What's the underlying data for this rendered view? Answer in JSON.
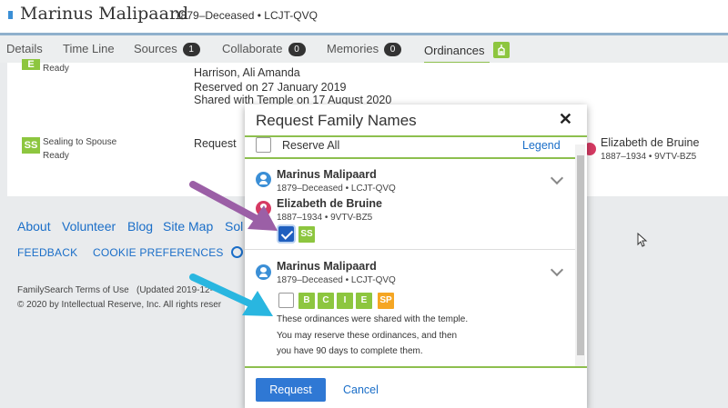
{
  "header": {
    "name": "Marinus Malipaard",
    "meta": "1879–Deceased • LCJT-QVQ"
  },
  "tabs": [
    {
      "label": "Details"
    },
    {
      "label": "Time Line"
    },
    {
      "label": "Sources",
      "count": "1"
    },
    {
      "label": "Collaborate",
      "count": "0"
    },
    {
      "label": "Memories",
      "count": "0"
    },
    {
      "label": "Ordinances",
      "active": true
    }
  ],
  "card": {
    "top_icon": "E",
    "top_status": "Ready",
    "reserved_by": "Harrison, Ali Amanda",
    "reserved_on": "Reserved on 27 January 2019",
    "shared_on": "Shared with Temple on 17 August 2020",
    "sealing_icon": "SS",
    "sealing_label": "Sealing to Spouse",
    "sealing_status": "Ready",
    "request_link": "Request",
    "spouse_name": "Elizabeth de Bruine",
    "spouse_meta": "1887–1934 • 9VTV-BZ5"
  },
  "footer": {
    "links": [
      "About",
      "Volunteer",
      "Blog",
      "Site Map",
      "Sol"
    ],
    "caps": [
      "FEEDBACK",
      "COOKIE PREFERENCES"
    ],
    "terms_link": "FamilySearch Terms of Use",
    "terms_updated": "(Updated 2019-12-",
    "copyright": "© 2020 by Intellectual Reserve, Inc. All rights reser"
  },
  "modal": {
    "title": "Request Family Names",
    "close": "✕",
    "reserve_all": "Reserve All",
    "legend": "Legend",
    "group1": {
      "person_name": "Marinus Malipaard",
      "person_meta": "1879–Deceased • LCJT-QVQ",
      "spouse_name": "Elizabeth de Bruine",
      "spouse_meta": "1887–1934 • 9VTV-BZ5",
      "ordinance": "SS"
    },
    "group2": {
      "person_name": "Marinus Malipaard",
      "person_meta": "1879–Deceased • LCJT-QVQ",
      "ordinances": [
        "B",
        "C",
        "I",
        "E",
        "SP"
      ],
      "note_line1": "These ordinances were shared with the temple.",
      "note_line2": "You may reserve these ordinances, and then",
      "note_line3": "you have 90 days to complete them."
    },
    "request_button": "Request",
    "cancel_button": "Cancel"
  },
  "colors": {
    "accent_green": "#8dc63f",
    "link_blue": "#1a6ec8",
    "button_blue": "#2f78d4",
    "annotation_purple": "#9b5fa6",
    "annotation_cyan": "#29b6e0"
  }
}
